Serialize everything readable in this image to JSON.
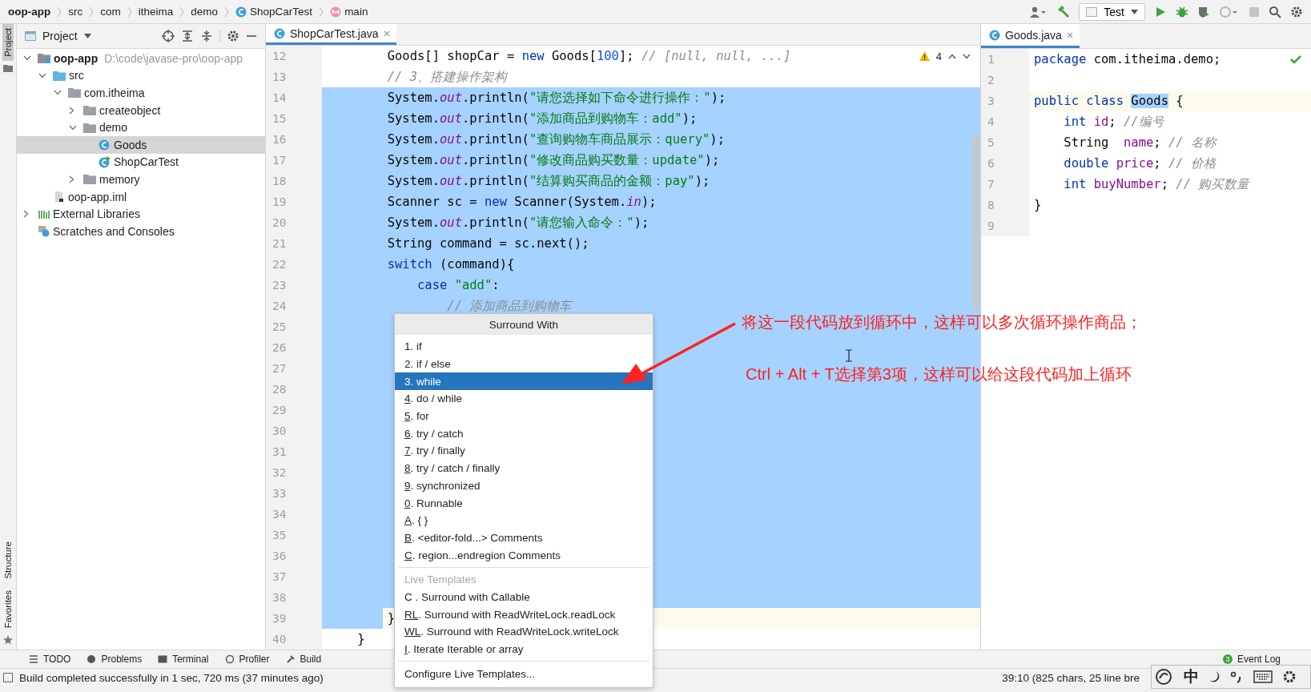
{
  "breadcrumbs": [
    {
      "text": "oop-app",
      "kind": "text",
      "bold": true
    },
    {
      "text": "src",
      "kind": "text",
      "bold": false
    },
    {
      "text": "com",
      "kind": "text",
      "bold": false
    },
    {
      "text": "itheima",
      "kind": "text",
      "bold": false
    },
    {
      "text": "demo",
      "kind": "text",
      "bold": false
    },
    {
      "text": "ShopCarTest",
      "kind": "class",
      "bold": false
    },
    {
      "text": "main",
      "kind": "method",
      "bold": false
    }
  ],
  "toolbar": {
    "run_config": "Test"
  },
  "side_strip": {
    "top": [
      {
        "label": "Project",
        "selected": true
      }
    ],
    "bottom": [
      {
        "label": "Structure",
        "selected": false
      },
      {
        "label": "Favorites",
        "selected": false
      }
    ]
  },
  "project_panel": {
    "title": "Project",
    "tree": [
      {
        "label": "oop-app",
        "hint": "D:\\code\\javase-pro\\oop-app",
        "kind": "module",
        "bold": true,
        "expanded": true,
        "selected": false,
        "children": [
          {
            "label": "src",
            "kind": "source-folder",
            "bold": false,
            "expanded": true,
            "selected": false,
            "children": [
              {
                "label": "com.itheima",
                "kind": "package",
                "bold": false,
                "expanded": true,
                "selected": false,
                "children": [
                  {
                    "label": "createobject",
                    "kind": "package",
                    "bold": false,
                    "expanded": false,
                    "selected": false
                  },
                  {
                    "label": "demo",
                    "kind": "package",
                    "bold": false,
                    "expanded": true,
                    "selected": false,
                    "children": [
                      {
                        "label": "Goods",
                        "kind": "class",
                        "bold": false,
                        "selected": true
                      },
                      {
                        "label": "ShopCarTest",
                        "kind": "main-class",
                        "bold": false,
                        "selected": false
                      }
                    ]
                  },
                  {
                    "label": "memory",
                    "kind": "package",
                    "bold": false,
                    "expanded": false,
                    "selected": false
                  }
                ]
              }
            ]
          },
          {
            "label": "oop-app.iml",
            "kind": "file",
            "bold": false,
            "selected": false
          }
        ]
      },
      {
        "label": "External Libraries",
        "kind": "libraries",
        "bold": false,
        "expanded": false,
        "selected": false
      },
      {
        "label": "Scratches and Consoles",
        "kind": "scratches",
        "bold": false,
        "selected": false
      }
    ]
  },
  "main_editor": {
    "tab": {
      "label": "ShopCarTest.java",
      "selected": true
    },
    "warnings": "4",
    "lines": [
      {
        "number": "12",
        "kind": "statement",
        "selected": false,
        "caret": false,
        "tokens": [
          {
            "kind": "plain",
            "text": "Goods[] shopCar = "
          },
          {
            "kind": "keyword",
            "text": "new"
          },
          {
            "kind": "plain",
            "text": " Goods["
          },
          {
            "kind": "number",
            "text": "100"
          },
          {
            "kind": "plain",
            "text": "]; "
          },
          {
            "kind": "comment",
            "text": "// [null, null, ...]"
          }
        ]
      },
      {
        "number": "13",
        "kind": "statement",
        "selected": false,
        "caret": false,
        "tokens": [
          {
            "kind": "comment",
            "text": "// 3、搭建操作架构"
          }
        ]
      },
      {
        "number": "14",
        "kind": "statement",
        "selected": true,
        "caret": false,
        "tokens": [
          {
            "kind": "plain",
            "text": "System."
          },
          {
            "kind": "field",
            "text": "out"
          },
          {
            "kind": "plain",
            "text": ".println("
          },
          {
            "kind": "string",
            "text": "\"请您选择如下命令进行操作：\""
          },
          {
            "kind": "plain",
            "text": ");"
          }
        ]
      },
      {
        "number": "15",
        "kind": "statement",
        "selected": true,
        "caret": false,
        "tokens": [
          {
            "kind": "plain",
            "text": "System."
          },
          {
            "kind": "field",
            "text": "out"
          },
          {
            "kind": "plain",
            "text": ".println("
          },
          {
            "kind": "string",
            "text": "\"添加商品到购物车：add\""
          },
          {
            "kind": "plain",
            "text": ");"
          }
        ]
      },
      {
        "number": "16",
        "kind": "statement",
        "selected": true,
        "caret": false,
        "tokens": [
          {
            "kind": "plain",
            "text": "System."
          },
          {
            "kind": "field",
            "text": "out"
          },
          {
            "kind": "plain",
            "text": ".println("
          },
          {
            "kind": "string",
            "text": "\"查询购物车商品展示：query\""
          },
          {
            "kind": "plain",
            "text": ");"
          }
        ]
      },
      {
        "number": "17",
        "kind": "statement",
        "selected": true,
        "caret": false,
        "tokens": [
          {
            "kind": "plain",
            "text": "System."
          },
          {
            "kind": "field",
            "text": "out"
          },
          {
            "kind": "plain",
            "text": ".println("
          },
          {
            "kind": "string",
            "text": "\"修改商品购买数量：update\""
          },
          {
            "kind": "plain",
            "text": ");"
          }
        ]
      },
      {
        "number": "18",
        "kind": "statement",
        "selected": true,
        "caret": false,
        "tokens": [
          {
            "kind": "plain",
            "text": "System."
          },
          {
            "kind": "field",
            "text": "out"
          },
          {
            "kind": "plain",
            "text": ".println("
          },
          {
            "kind": "string",
            "text": "\"结算购买商品的金额：pay\""
          },
          {
            "kind": "plain",
            "text": ");"
          }
        ]
      },
      {
        "number": "19",
        "kind": "statement",
        "selected": true,
        "caret": false,
        "tokens": [
          {
            "kind": "plain",
            "text": "Scanner sc = "
          },
          {
            "kind": "keyword",
            "text": "new"
          },
          {
            "kind": "plain",
            "text": " Scanner(System."
          },
          {
            "kind": "field",
            "text": "in"
          },
          {
            "kind": "plain",
            "text": ");"
          }
        ]
      },
      {
        "number": "20",
        "kind": "statement",
        "selected": true,
        "caret": false,
        "tokens": [
          {
            "kind": "plain",
            "text": "System."
          },
          {
            "kind": "field",
            "text": "out"
          },
          {
            "kind": "plain",
            "text": ".println("
          },
          {
            "kind": "string",
            "text": "\"请您输入命令：\""
          },
          {
            "kind": "plain",
            "text": ");"
          }
        ]
      },
      {
        "number": "21",
        "kind": "statement",
        "selected": true,
        "caret": false,
        "tokens": [
          {
            "kind": "plain",
            "text": "String command = sc.next();"
          }
        ]
      },
      {
        "number": "22",
        "kind": "statement",
        "selected": true,
        "caret": false,
        "tokens": [
          {
            "kind": "keyword",
            "text": "switch"
          },
          {
            "kind": "plain",
            "text": " (command){"
          }
        ]
      },
      {
        "number": "23",
        "kind": "case",
        "selected": true,
        "caret": false,
        "tokens": [
          {
            "kind": "keyword",
            "text": "case"
          },
          {
            "kind": "string",
            "text": " \"add\""
          },
          {
            "kind": "plain",
            "text": ":"
          }
        ]
      },
      {
        "number": "24",
        "kind": "case-body",
        "selected": true,
        "caret": false,
        "tokens": [
          {
            "kind": "comment",
            "text": "// 添加商品到购物车"
          }
        ]
      },
      {
        "number": "25",
        "selected": true,
        "caret": false
      },
      {
        "number": "26",
        "selected": true,
        "caret": false
      },
      {
        "number": "27",
        "selected": true,
        "caret": false
      },
      {
        "number": "28",
        "selected": true,
        "caret": false
      },
      {
        "number": "29",
        "selected": true,
        "caret": false
      },
      {
        "number": "30",
        "selected": true,
        "caret": false
      },
      {
        "number": "31",
        "selected": true,
        "caret": false
      },
      {
        "number": "32",
        "selected": true,
        "caret": false
      },
      {
        "number": "33",
        "selected": true,
        "caret": false
      },
      {
        "number": "34",
        "selected": true,
        "caret": false
      },
      {
        "number": "35",
        "selected": true,
        "caret": false
      },
      {
        "number": "36",
        "selected": true,
        "caret": false
      },
      {
        "number": "37",
        "selected": true,
        "caret": false
      },
      {
        "number": "38",
        "selected": true,
        "caret": false
      },
      {
        "number": "39",
        "kind": "statement",
        "selected": true,
        "caret": true,
        "tokens": [
          {
            "kind": "plain",
            "text": "}"
          }
        ]
      },
      {
        "number": "40",
        "kind": "member",
        "selected": false,
        "caret": false,
        "tokens": [
          {
            "kind": "plain",
            "text": "}"
          }
        ]
      }
    ]
  },
  "side_editor": {
    "tab": {
      "label": "Goods.java",
      "selected": true
    },
    "lines": [
      {
        "number": "1",
        "kind": "top",
        "caret": false,
        "tokens": [
          {
            "kind": "keyword",
            "text": "package"
          },
          {
            "kind": "plain",
            "text": " com.itheima.demo;"
          }
        ]
      },
      {
        "number": "2",
        "caret": false
      },
      {
        "number": "3",
        "kind": "top",
        "caret": true,
        "tokens": [
          {
            "kind": "keyword",
            "text": "public class"
          },
          {
            "kind": "match",
            "text": "Goods"
          },
          {
            "kind": "plain",
            "text": " {"
          }
        ]
      },
      {
        "number": "4",
        "kind": "member",
        "caret": false,
        "tokens": [
          {
            "kind": "keyword",
            "text": "int"
          },
          {
            "kind": "member",
            "text": "id"
          },
          {
            "kind": "plain",
            "text": "; "
          },
          {
            "kind": "comment",
            "text": "//编号"
          }
        ]
      },
      {
        "number": "5",
        "kind": "member",
        "caret": false,
        "tokens": [
          {
            "kind": "plain",
            "text": "String "
          },
          {
            "kind": "member",
            "text": "name"
          },
          {
            "kind": "plain",
            "text": "; "
          },
          {
            "kind": "comment",
            "text": "// 名称"
          }
        ]
      },
      {
        "number": "6",
        "kind": "member",
        "caret": false,
        "tokens": [
          {
            "kind": "keyword",
            "text": "double"
          },
          {
            "kind": "member",
            "text": "price"
          },
          {
            "kind": "plain",
            "text": "; "
          },
          {
            "kind": "comment",
            "text": "// 价格"
          }
        ]
      },
      {
        "number": "7",
        "kind": "member",
        "caret": false,
        "tokens": [
          {
            "kind": "keyword",
            "text": "int"
          },
          {
            "kind": "member",
            "text": "buyNumber"
          },
          {
            "kind": "plain",
            "text": "; "
          },
          {
            "kind": "comment",
            "text": "// 购买数量"
          }
        ]
      },
      {
        "number": "8",
        "kind": "top",
        "caret": false,
        "tokens": [
          {
            "kind": "plain",
            "text": "}"
          }
        ]
      },
      {
        "number": "9",
        "caret": false
      }
    ]
  },
  "surround_popup": {
    "title": "Surround With",
    "items": [
      {
        "key": "1",
        "rest": ". if",
        "underline": false,
        "selected": false
      },
      {
        "key": "2",
        "rest": ". if / else",
        "underline": false,
        "selected": false
      },
      {
        "key": "3",
        "rest": ". while",
        "underline": false,
        "selected": true
      },
      {
        "key": "4",
        "rest": ". do / while",
        "underline": true,
        "selected": false
      },
      {
        "key": "5",
        "rest": ". for",
        "underline": true,
        "selected": false
      },
      {
        "key": "6",
        "rest": ". try / catch",
        "underline": true,
        "selected": false
      },
      {
        "key": "7",
        "rest": ". try / finally",
        "underline": true,
        "selected": false
      },
      {
        "key": "8",
        "rest": ". try / catch / finally",
        "underline": true,
        "selected": false
      },
      {
        "key": "9",
        "rest": ". synchronized",
        "underline": true,
        "selected": false
      },
      {
        "key": "0",
        "rest": ". Runnable",
        "underline": true,
        "selected": false
      },
      {
        "key": "A",
        "rest": ". { }",
        "underline": true,
        "selected": false
      },
      {
        "key": "B",
        "rest": ". <editor-fold...> Comments",
        "underline": true,
        "selected": false
      },
      {
        "key": "C",
        "rest": ". region...endregion Comments",
        "underline": true,
        "selected": false
      }
    ],
    "group_title": "Live Templates",
    "live_items": [
      {
        "key": "C",
        "rest": " . Surround with Callable",
        "underline": false,
        "selected": false
      },
      {
        "key": "RL",
        "rest": ". Surround with ReadWriteLock.readLock",
        "underline": true,
        "selected": false
      },
      {
        "key": "WL",
        "rest": ". Surround with ReadWriteLock.writeLock",
        "underline": true,
        "selected": false
      },
      {
        "key": "I",
        "rest": ". Iterate Iterable or array",
        "underline": true,
        "selected": false
      }
    ],
    "footer": "Configure Live Templates..."
  },
  "annotations": [
    "将这一段代码放到循环中，这样可以多次循环操作商品；",
    "Ctrl + Alt + T选择第3项，这样可以给这段代码加上循环"
  ],
  "tool_windows": [
    "TODO",
    "Problems",
    "Terminal",
    "Profiler",
    "Build"
  ],
  "event_log": {
    "label": "Event Log",
    "badge": "3"
  },
  "status_bar": {
    "message": "Build completed successfully in 1 sec, 720 ms (37 minutes ago)",
    "position": "39:10 (825 chars, 25 line bre"
  },
  "ime_bar": {
    "mode": "中"
  }
}
